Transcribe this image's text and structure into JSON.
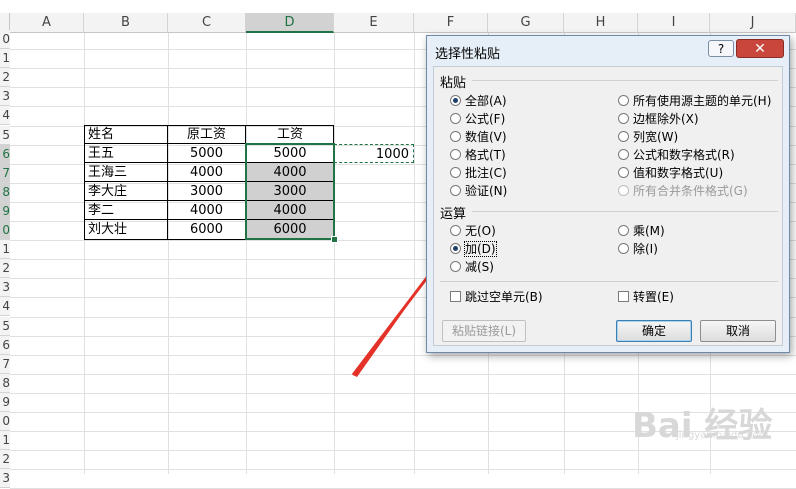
{
  "columns": [
    "A",
    "B",
    "C",
    "D",
    "E",
    "F",
    "G",
    "H",
    "I",
    "J"
  ],
  "rows": [
    "0",
    "1",
    "2",
    "3",
    "4",
    "5",
    "6",
    "7",
    "8",
    "9",
    "0",
    "1",
    "2",
    "3",
    "4",
    "5",
    "6",
    "7",
    "8",
    "9",
    "0",
    "1",
    "2",
    "3"
  ],
  "table": {
    "headers": [
      "姓名",
      "原工资",
      "工资"
    ],
    "rows": [
      [
        "王五",
        "5000",
        "5000"
      ],
      [
        "王海三",
        "4000",
        "4000"
      ],
      [
        "李大庄",
        "3000",
        "3000"
      ],
      [
        "李二",
        "4000",
        "4000"
      ],
      [
        "刘大壮",
        "6000",
        "6000"
      ]
    ]
  },
  "copied_cell_value": "1000",
  "dialog": {
    "title": "选择性粘贴",
    "help_label": "?",
    "close_label": "✕",
    "paste_group": "粘贴",
    "paste_options_left": [
      "全部(A)",
      "公式(F)",
      "数值(V)",
      "格式(T)",
      "批注(C)",
      "验证(N)"
    ],
    "paste_options_right": [
      "所有使用源主题的单元(H)",
      "边框除外(X)",
      "列宽(W)",
      "公式和数字格式(R)",
      "值和数字格式(U)",
      "所有合并条件格式(G)"
    ],
    "operation_group": "运算",
    "operation_left": [
      "无(O)",
      "加(D)",
      "减(S)"
    ],
    "operation_right": [
      "乘(M)",
      "除(I)"
    ],
    "skip_blanks": "跳过空单元(B)",
    "transpose": "转置(E)",
    "paste_link": "粘贴链接(L)",
    "ok": "确定",
    "cancel": "取消"
  },
  "watermark": "Bai 经验",
  "watermark_sub": "jingyan.baidu.com",
  "colors": {
    "accent": "#217346",
    "annotation_arrow": "#e53228",
    "selected_fill": "#d0d0d0"
  }
}
